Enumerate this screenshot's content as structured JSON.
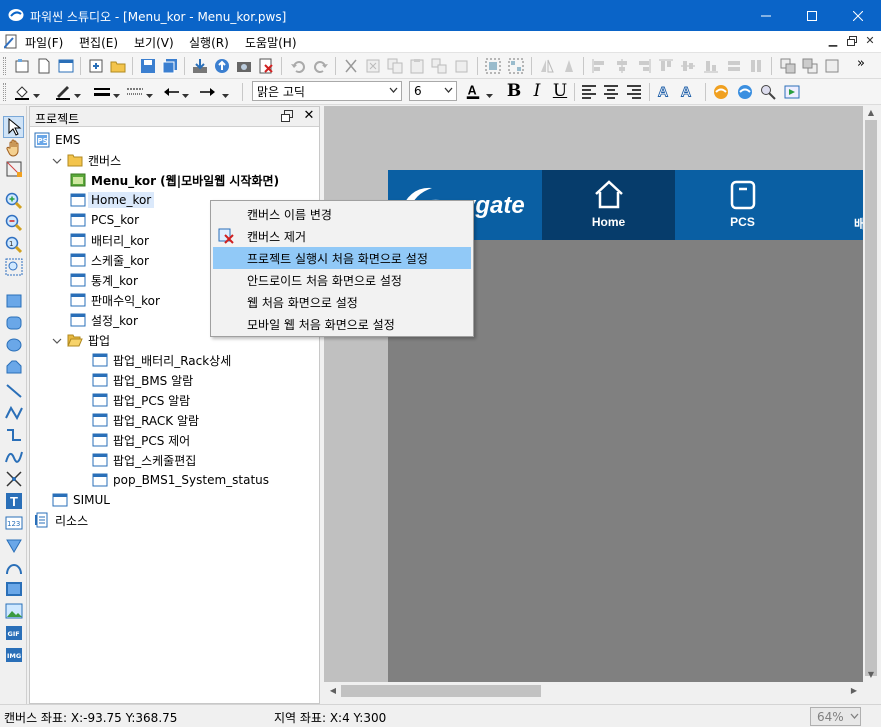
{
  "window": {
    "title": "파워씬 스튜디오 - [Menu_kor - Menu_kor.pws]",
    "controls": [
      "minimize",
      "maximize",
      "close"
    ]
  },
  "menubar": {
    "items": [
      {
        "label": "파일(F)"
      },
      {
        "label": "편집(E)"
      },
      {
        "label": "보기(V)"
      },
      {
        "label": "실행(R)"
      },
      {
        "label": "도움말(H)"
      }
    ],
    "mdi_controls": [
      "▁",
      "🗗",
      "✕"
    ]
  },
  "toolbar": {
    "font_name": "맑은 고딕",
    "font_size": "6",
    "bold": "B",
    "italic": "I",
    "underline": "U"
  },
  "panel": {
    "title": "프로젝트",
    "tree": [
      {
        "label": "EMS",
        "level": 0,
        "icon": "project-icon"
      },
      {
        "label": "캔버스",
        "level": 1,
        "icon": "folder-icon",
        "expanded": true
      },
      {
        "label": "Menu_kor (웹|모바일웹 시작화면)",
        "level": 2,
        "icon": "start-canvas-icon",
        "bold": true
      },
      {
        "label": "Home_kor",
        "level": 2,
        "icon": "canvas-icon",
        "selected": true
      },
      {
        "label": "PCS_kor",
        "level": 2,
        "icon": "canvas-icon"
      },
      {
        "label": "배터리_kor",
        "level": 2,
        "icon": "canvas-icon"
      },
      {
        "label": "스케줄_kor",
        "level": 2,
        "icon": "canvas-icon"
      },
      {
        "label": "통계_kor",
        "level": 2,
        "icon": "canvas-icon"
      },
      {
        "label": "판매수익_kor",
        "level": 2,
        "icon": "canvas-icon"
      },
      {
        "label": "설정_kor",
        "level": 2,
        "icon": "canvas-icon"
      },
      {
        "label": "팝업",
        "level": 1,
        "icon": "folder-open-icon",
        "expanded": true
      },
      {
        "label": "팝업_배터리_Rack상세",
        "level": 2,
        "icon": "canvas-icon"
      },
      {
        "label": "팝업_BMS 알람",
        "level": 2,
        "icon": "canvas-icon"
      },
      {
        "label": "팝업_PCS 알람",
        "level": 2,
        "icon": "canvas-icon"
      },
      {
        "label": "팝업_RACK 알람",
        "level": 2,
        "icon": "canvas-icon"
      },
      {
        "label": "팝업_PCS 제어",
        "level": 2,
        "icon": "canvas-icon"
      },
      {
        "label": "팝업_스케줄편집",
        "level": 2,
        "icon": "canvas-icon"
      },
      {
        "label": "pop_BMS1_System_status",
        "level": 2,
        "icon": "canvas-icon"
      },
      {
        "label": "SIMUL",
        "level": 1,
        "icon": "canvas-icon"
      },
      {
        "label": "리소스",
        "level": 0,
        "icon": "resource-icon"
      }
    ]
  },
  "canvas": {
    "logo_text": "enygate",
    "nav": [
      {
        "label": "Home",
        "icon": "home-icon"
      },
      {
        "label": "PCS",
        "icon": "pcs-icon"
      },
      {
        "label": "배",
        "icon": "battery-icon"
      }
    ]
  },
  "context_menu": {
    "items": [
      {
        "label": "캔버스 이름 변경"
      },
      {
        "label": "캔버스 제거",
        "icon": "remove-canvas-icon"
      },
      {
        "label": "프로젝트 실행시 처음 화면으로 설정",
        "highlighted": true
      },
      {
        "label": "안드로이드 처음 화면으로 설정"
      },
      {
        "label": "웹 처음 화면으로 설정"
      },
      {
        "label": "모바일 웹 처음 화면으로 설정"
      }
    ]
  },
  "status": {
    "canvas_coord": "캔버스 좌표: X:-93.75 Y:368.75",
    "region_coord": "지역 좌표: X:4 Y:300",
    "zoom": "64%"
  },
  "colors": {
    "titlebar": "#0a64c8",
    "banner": "#0a5fa3",
    "banner_active": "#063c6b",
    "selection": "#dbe9fb",
    "menu_highlight": "#91c9f7"
  }
}
